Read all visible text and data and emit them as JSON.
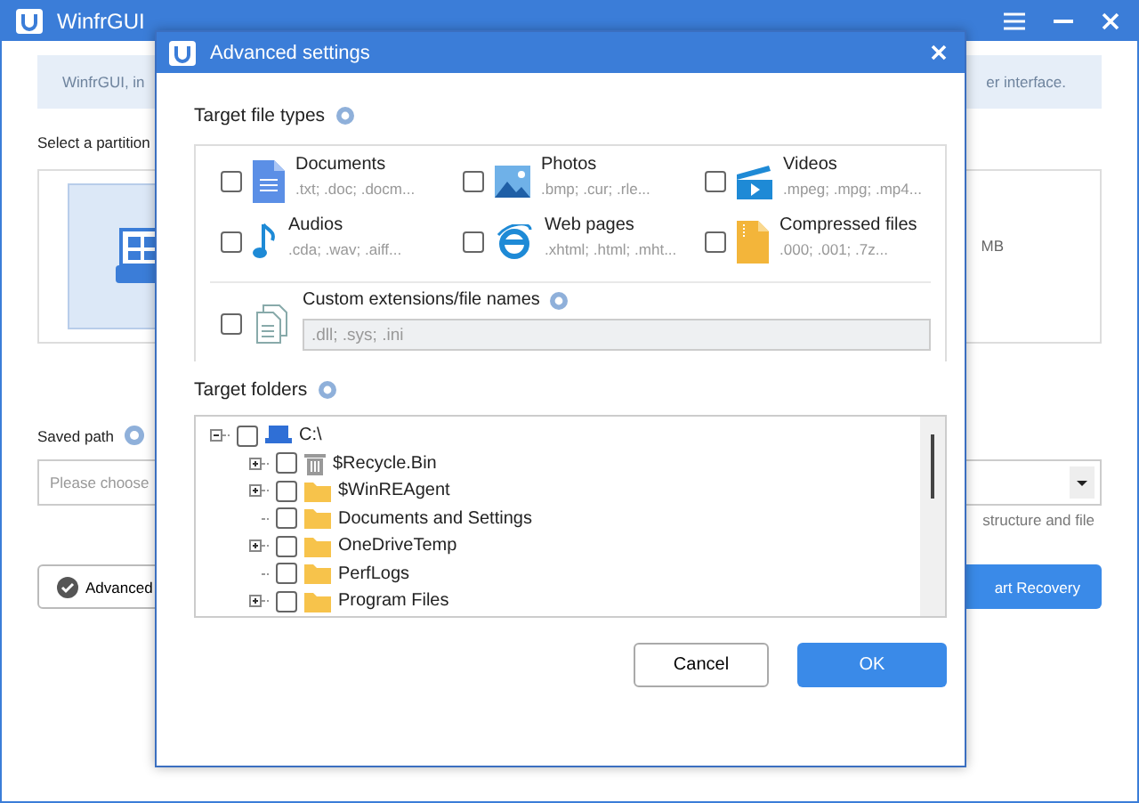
{
  "window": {
    "title": "WinfrGUI"
  },
  "background": {
    "banner_left": "WinfrGUI, in",
    "banner_right": "er interface.",
    "partition_label": "Select a partition",
    "partition_size": "MB",
    "saved_path_label": "Saved path",
    "saved_path_placeholder": "Please choose",
    "saved_path_hint": "structure and file",
    "advanced_button": "Advanced",
    "recovery_button": "art Recovery"
  },
  "dialog": {
    "title": "Advanced settings",
    "file_types_label": "Target file types",
    "file_types": [
      {
        "kind": "documents",
        "name": "Documents",
        "extensions": ".txt; .doc; .docm...",
        "checked": false
      },
      {
        "kind": "photos",
        "name": "Photos",
        "extensions": ".bmp; .cur; .rle...",
        "checked": false
      },
      {
        "kind": "videos",
        "name": "Videos",
        "extensions": ".mpeg; .mpg; .mp4...",
        "checked": false
      },
      {
        "kind": "audios",
        "name": "Audios",
        "extensions": ".cda; .wav; .aiff...",
        "checked": false
      },
      {
        "kind": "web",
        "name": "Web pages",
        "extensions": ".xhtml; .html; .mht...",
        "checked": false
      },
      {
        "kind": "compressed",
        "name": "Compressed files",
        "extensions": ".000; .001; .7z...",
        "checked": false
      }
    ],
    "custom": {
      "label": "Custom extensions/file names",
      "placeholder": ".dll; .sys; .ini",
      "checked": false
    },
    "folders_label": "Target folders",
    "folders": [
      {
        "kind": "drive",
        "name": "C:\\",
        "checked": false,
        "expanded": true,
        "children": [
          {
            "kind": "trash",
            "name": "$Recycle.Bin",
            "checked": false,
            "expanded": false
          },
          {
            "kind": "folder",
            "name": "$WinREAgent",
            "checked": false,
            "expanded": false
          },
          {
            "kind": "folder",
            "name": "Documents and Settings",
            "checked": false
          },
          {
            "kind": "folder",
            "name": "OneDriveTemp",
            "checked": false,
            "expanded": false
          },
          {
            "kind": "folder",
            "name": "PerfLogs",
            "checked": false
          },
          {
            "kind": "folder",
            "name": "Program Files",
            "checked": false,
            "expanded": false
          }
        ]
      }
    ],
    "buttons": [
      {
        "kind": "secondary",
        "label": "Cancel"
      },
      {
        "kind": "primary",
        "label": "OK"
      }
    ]
  }
}
